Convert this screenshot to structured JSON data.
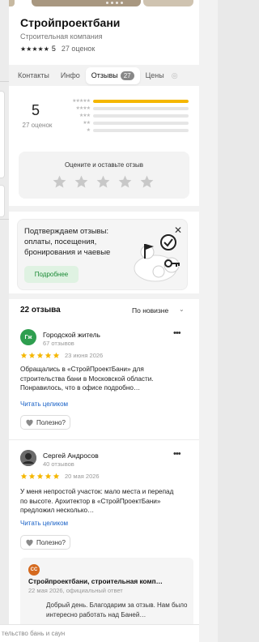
{
  "organization": {
    "name": "Стройпроектбани",
    "category": "Строительная компания",
    "rating": "5",
    "reviews_count_label": "27 оценок"
  },
  "tabs": [
    {
      "label": "Контакты"
    },
    {
      "label": "Инфо"
    },
    {
      "label": "Отзывы",
      "badge": "27",
      "active": true
    },
    {
      "label": "Цены"
    }
  ],
  "rating_summary": {
    "value": "5",
    "count_label": "27 оценок",
    "distribution": [
      {
        "stars": 5,
        "fraction": 1.0
      },
      {
        "stars": 4,
        "fraction": 0
      },
      {
        "stars": 3,
        "fraction": 0
      },
      {
        "stars": 2,
        "fraction": 0
      },
      {
        "stars": 1,
        "fraction": 0
      }
    ]
  },
  "rate_prompt": {
    "label": "Оцените и оставьте отзыв"
  },
  "promo": {
    "text": "Подтверждаем отзывы: оплаты, посещения, бронирования и чаевые",
    "button": "Подробнее"
  },
  "reviews_header": {
    "count": "22 отзыва",
    "sort": "По новизне"
  },
  "reviews": [
    {
      "avatar_initials": "Гж",
      "avatar_color": "#2e9e4f",
      "author": "Городской житель",
      "author_sub": "67 отзывов",
      "rating": 5,
      "date": "23 июня 2026",
      "text": "Обращались в «СтройПроектБани» для строительства бани в Московской области. Понравилось, что в офисе подробно…",
      "read_more": "Читать целиком",
      "useful": "Полезно?"
    },
    {
      "avatar_initials": "",
      "avatar_color": "#5a5a5a",
      "author": "Сергей Андросов",
      "author_sub": "40 отзывов",
      "rating": 5,
      "date": "20 мая 2026",
      "text": "У меня непростой участок: мало места и перепад по высоте. Архитектор в «СтройПроектБани» предложил несколько…",
      "read_more": "Читать целиком",
      "useful": "Полезно?"
    }
  ],
  "owner_reply": {
    "logo_initials": "СС",
    "title": "Стройпроектбани, строительная комп…",
    "date": "22 мая 2026, официальный ответ",
    "text": "Добрый день. Благодарим за отзыв. Нам было интересно работать над Баней…"
  },
  "bottom_bar": {
    "text": "тельство бань и саун"
  },
  "colors": {
    "star_gold": "#f5b700",
    "link": "#1a62c7",
    "accent_green": "#1a8a35"
  }
}
